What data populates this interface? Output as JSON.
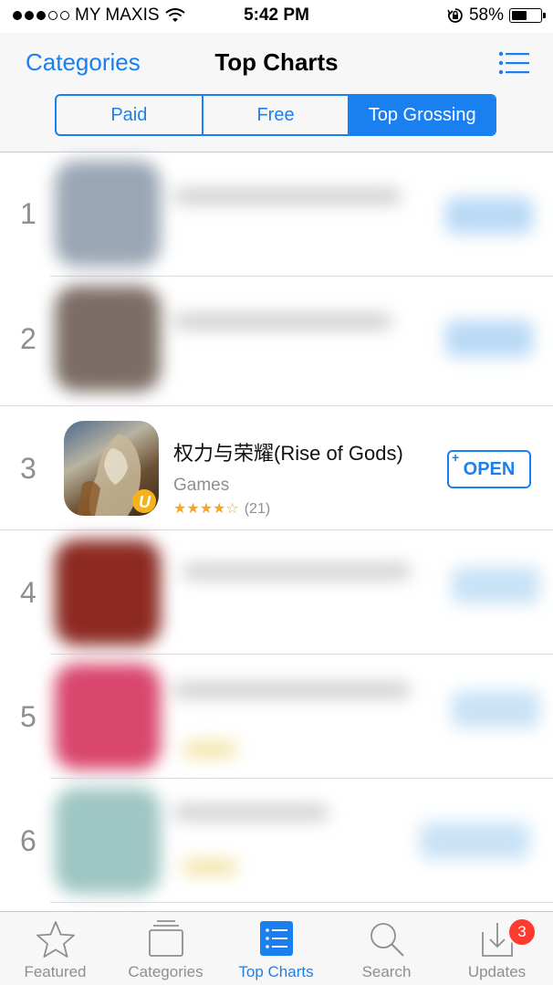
{
  "status_bar": {
    "carrier": "MY MAXIS",
    "time": "5:42 PM",
    "battery": "58%",
    "battery_level": 0.58,
    "signal_bars_filled": 3,
    "signal_bars_total": 5
  },
  "nav": {
    "back_label": "Categories",
    "title": "Top Charts",
    "list_icon": "list-icon"
  },
  "segments": [
    {
      "label": "Paid",
      "active": false
    },
    {
      "label": "Free",
      "active": false
    },
    {
      "label": "Top Grossing",
      "active": true
    }
  ],
  "ranks": [
    "1",
    "2",
    "3",
    "4",
    "5",
    "6"
  ],
  "featured_app": {
    "rank": "3",
    "title": "权力与荣耀(Rise of Gods)",
    "category": "Games",
    "stars": "★★★★☆",
    "rating": 3.5,
    "rating_count": "(21)",
    "button_label": "OPEN",
    "button_plus": "+",
    "icon": "game-warrior-icon"
  },
  "tab_bar": {
    "items": [
      {
        "label": "Featured",
        "icon": "star-icon",
        "active": false
      },
      {
        "label": "Categories",
        "icon": "categories-icon",
        "active": false
      },
      {
        "label": "Top Charts",
        "icon": "top-charts-icon",
        "active": true
      },
      {
        "label": "Search",
        "icon": "search-icon",
        "active": false
      },
      {
        "label": "Updates",
        "icon": "updates-icon",
        "active": false
      }
    ],
    "updates_badge": "3"
  },
  "colors": {
    "accent": "#1a80ef",
    "badge": "#ff3b30",
    "star": "#f5a623"
  }
}
